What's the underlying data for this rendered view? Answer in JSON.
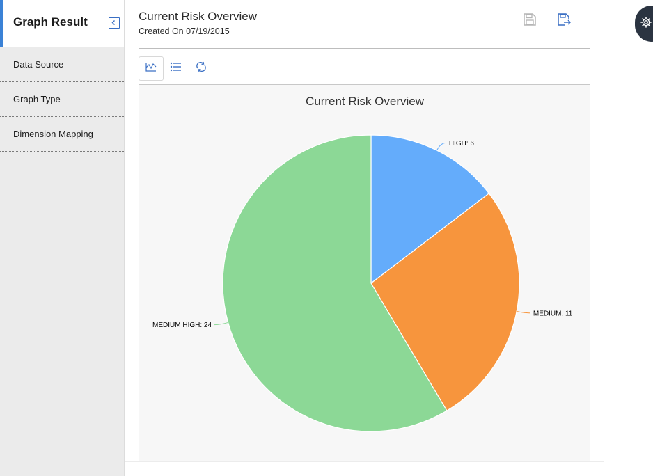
{
  "sidebar": {
    "title": "Graph Result",
    "items": [
      {
        "label": "Data Source"
      },
      {
        "label": "Graph Type"
      },
      {
        "label": "Dimension Mapping"
      }
    ]
  },
  "header": {
    "title": "Current Risk Overview",
    "subtitle": "Created On 07/19/2015",
    "icons": [
      "save-icon",
      "save-as-icon"
    ]
  },
  "toolbar": {
    "icons": [
      "chart-icon",
      "list-icon",
      "refresh-icon"
    ]
  },
  "colors": {
    "accent": "#3b82d6",
    "high": "#64acfb",
    "medium": "#f7953d",
    "medium_high": "#8cd896"
  },
  "chart_data": {
    "type": "pie",
    "title": "Current Risk Overview",
    "categories": [
      "HIGH",
      "MEDIUM",
      "MEDIUM HIGH"
    ],
    "values": [
      6,
      11,
      24
    ],
    "labels": [
      "HIGH: 6",
      "MEDIUM: 11",
      "MEDIUM HIGH: 24"
    ],
    "colors": [
      "#64acfb",
      "#f7953d",
      "#8cd896"
    ]
  }
}
